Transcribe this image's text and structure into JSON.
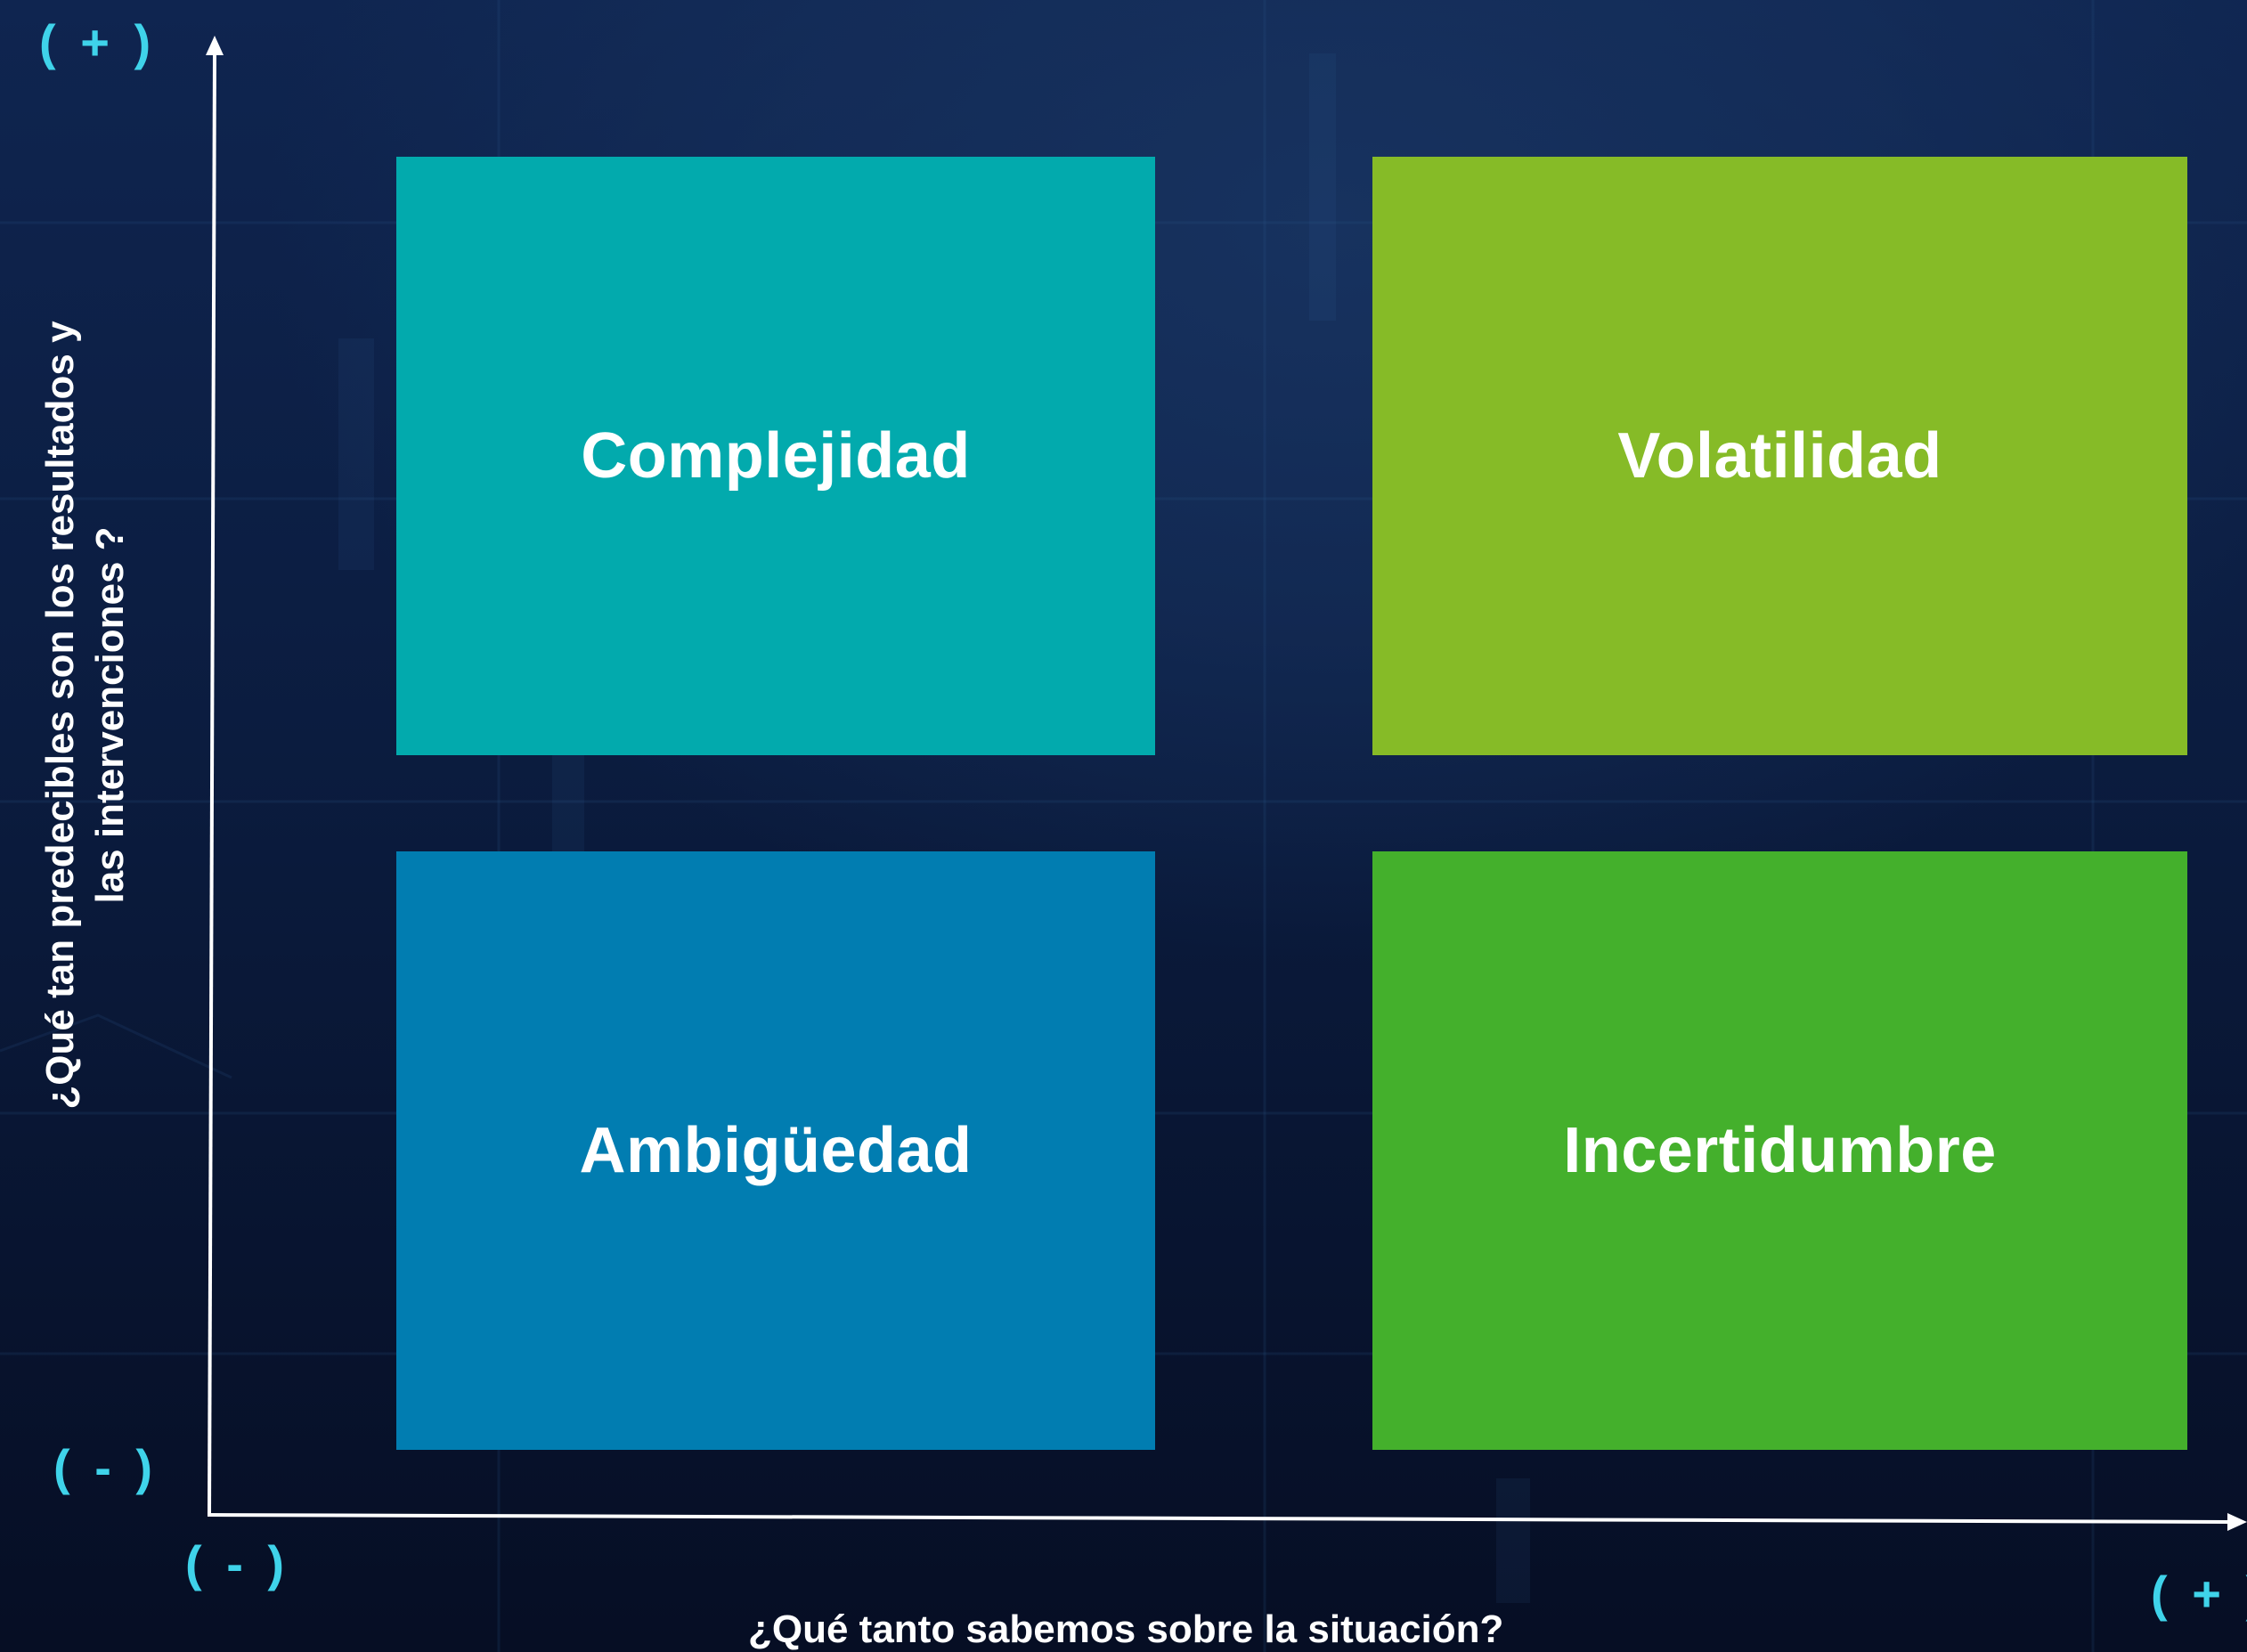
{
  "colors": {
    "complejidad": "#02aaad",
    "volatilidad": "#86bb27",
    "ambiguedad": "#017db1",
    "incertidumbre": "#44b02c",
    "marker": "#3fd3ea",
    "axis": "#ffffff"
  },
  "quadrants": {
    "complejidad": "Complejidad",
    "volatilidad": "Volatilidad",
    "ambiguedad": "Ambigüedad",
    "incertidumbre": "Incertidumbre"
  },
  "axes": {
    "x_title": "¿Qué tanto sabemos sobre la situación?",
    "y_title_line1": "¿Qué tan predecibles son los resultados y",
    "y_title_line2": "las intervenciones ?",
    "y_plus": "( + )",
    "y_minus": "( - )",
    "x_minus": "( - )",
    "x_plus": "( + )"
  }
}
